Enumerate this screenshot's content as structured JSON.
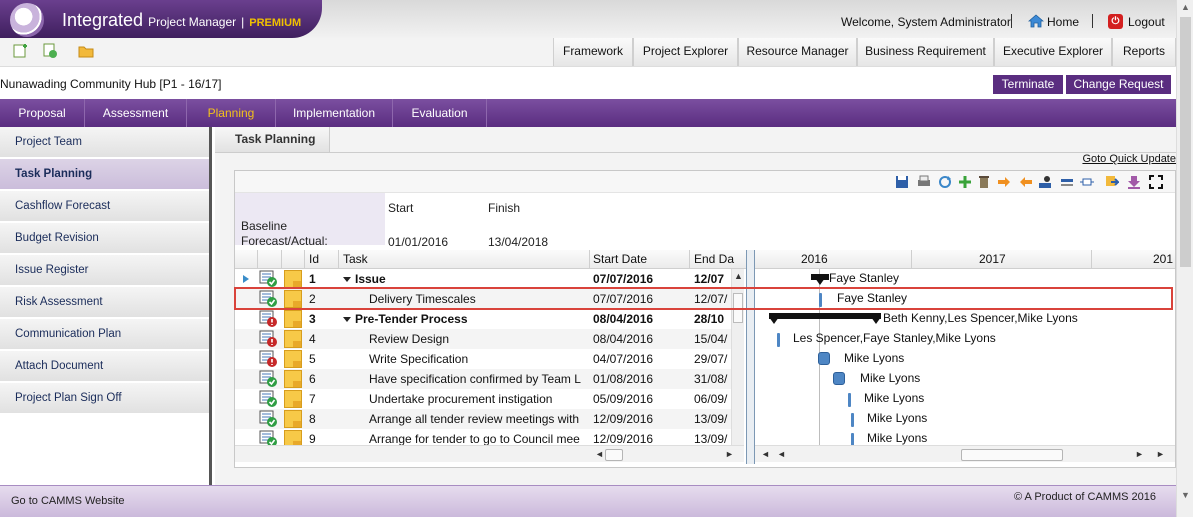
{
  "app": {
    "name": "Integrated",
    "name_suffix": "Project Manager",
    "edition": "PREMIUM",
    "welcome": "Welcome, System Administrator",
    "home_label": "Home",
    "logout_label": "Logout"
  },
  "main_nav": [
    "Framework",
    "Project Explorer",
    "Resource Manager",
    "Business Requirement",
    "Executive Explorer",
    "Reports"
  ],
  "project": {
    "title": "Nunawading Community Hub [P1 - 16/17]",
    "terminate_label": "Terminate",
    "change_request_label": "Change Request"
  },
  "phases": [
    "Proposal",
    "Assessment",
    "Planning",
    "Implementation",
    "Evaluation"
  ],
  "sidebar": [
    "Project Team",
    "Task Planning",
    "Cashflow Forecast",
    "Budget Revision",
    "Issue Register",
    "Risk Assessment",
    "Communication Plan",
    "Attach Document",
    "Project Plan Sign Off"
  ],
  "content": {
    "tab_label": "Task Planning",
    "quick_update": "Goto Quick Update"
  },
  "baseline": {
    "start_header": "Start",
    "finish_header": "Finish",
    "baseline_label": "Baseline",
    "forecast_label": "Forecast/Actual:",
    "start_value": "01/01/2016",
    "finish_value": "13/04/2018"
  },
  "grid": {
    "headers": {
      "id": "Id",
      "task": "Task",
      "start": "Start Date",
      "end": "End Da"
    },
    "rows": [
      {
        "id": "1",
        "task": "Issue",
        "start": "07/07/2016",
        "end": "12/07",
        "bold": true,
        "status": "ok"
      },
      {
        "id": "2",
        "task": "Delivery Timescales",
        "start": "07/07/2016",
        "end": "12/07/",
        "bold": false,
        "status": "ok"
      },
      {
        "id": "3",
        "task": "Pre-Tender Process",
        "start": "08/04/2016",
        "end": "28/10",
        "bold": true,
        "status": "alert"
      },
      {
        "id": "4",
        "task": "Review Design",
        "start": "08/04/2016",
        "end": "15/04/",
        "bold": false,
        "status": "alert"
      },
      {
        "id": "5",
        "task": "Write Specification",
        "start": "04/07/2016",
        "end": "29/07/",
        "bold": false,
        "status": "alert"
      },
      {
        "id": "6",
        "task": "Have specification confirmed by Team L",
        "start": "01/08/2016",
        "end": "31/08/",
        "bold": false,
        "status": "ok"
      },
      {
        "id": "7",
        "task": "Undertake procurement instigation",
        "start": "05/09/2016",
        "end": "06/09/",
        "bold": false,
        "status": "ok"
      },
      {
        "id": "8",
        "task": "Arrange all tender review meetings with",
        "start": "12/09/2016",
        "end": "13/09/",
        "bold": false,
        "status": "ok"
      },
      {
        "id": "9",
        "task": "Arrange for tender to go to Council mee",
        "start": "12/09/2016",
        "end": "13/09/",
        "bold": false,
        "status": "ok"
      }
    ]
  },
  "gantt": {
    "years": [
      "2016",
      "2017",
      "201"
    ],
    "labels": [
      "Faye Stanley",
      "Faye Stanley",
      "Beth Kenny,Les Spencer,Mike Lyons",
      "Les Spencer,Faye Stanley,Mike Lyons",
      "Mike Lyons",
      "Mike Lyons",
      "Mike Lyons",
      "Mike Lyons",
      "Mike Lyons"
    ]
  },
  "footer": {
    "left": "Go to CAMMS Website",
    "right": "© A Product of CAMMS 2016"
  },
  "colors": {
    "brand": "#5a2d80",
    "accent": "#f3c21a",
    "highlight": "#d9433b",
    "bar": "#4e86c4"
  }
}
